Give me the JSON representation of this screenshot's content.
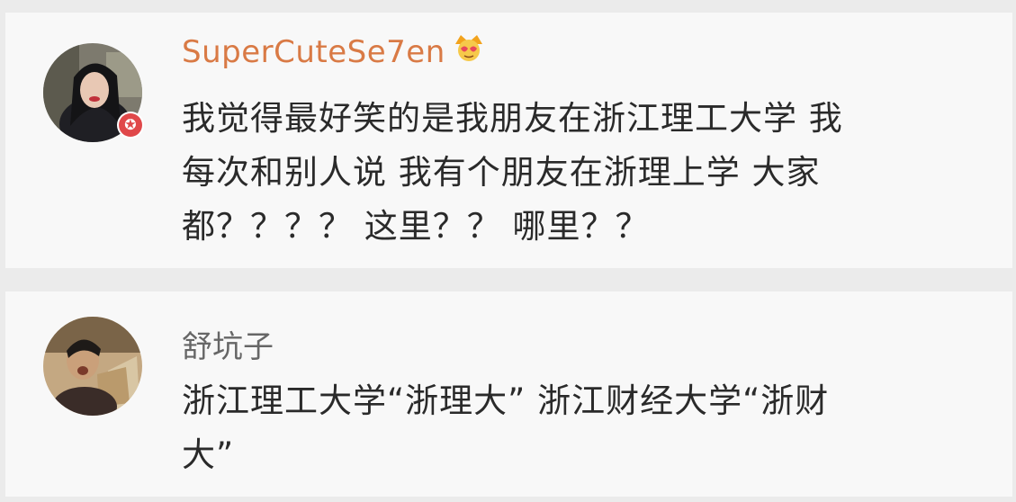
{
  "comments": [
    {
      "username": "SuperCuteSe7en",
      "text": "我觉得最好笑的是我朋友在浙江理工大学 我\n每次和别人说 我有个朋友在浙理上学 大家\n都？？？？ 这里？？ 哪里？？"
    },
    {
      "username": "舒坑子",
      "text": "浙江理工大学“浙理大” 浙江财经大学“浙财\n大”"
    }
  ],
  "colors": {
    "username_vip": "#d97a45",
    "username_normal": "#666666",
    "badge": "#e0484a"
  },
  "icons": {
    "vip_emoji": "crown-emoji-icon",
    "badge": "star-badge-icon"
  }
}
